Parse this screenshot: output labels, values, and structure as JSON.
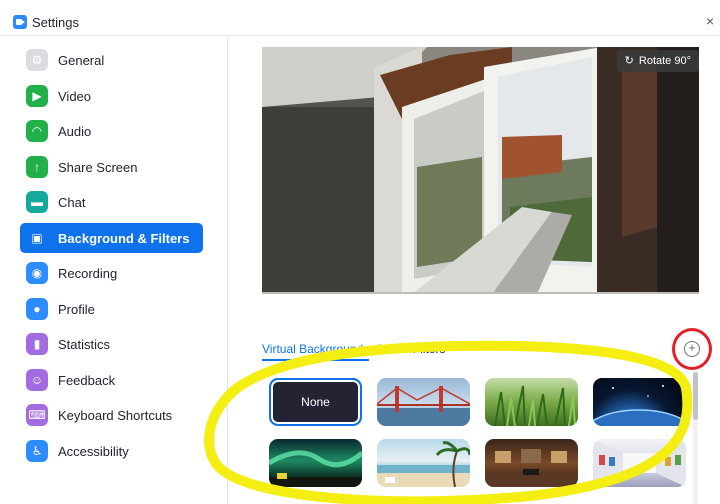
{
  "window": {
    "title": "Settings",
    "close_glyph": "×"
  },
  "sidebar": {
    "items": [
      {
        "label": "General",
        "icon": "gear-icon",
        "color": "#dcdce0",
        "glyph": "⚙"
      },
      {
        "label": "Video",
        "icon": "video-icon",
        "color": "#22b04a",
        "glyph": "▶"
      },
      {
        "label": "Audio",
        "icon": "headphones-icon",
        "color": "#22b04a",
        "glyph": "◠"
      },
      {
        "label": "Share Screen",
        "icon": "share-screen-icon",
        "color": "#22b04a",
        "glyph": "↑"
      },
      {
        "label": "Chat",
        "icon": "chat-icon",
        "color": "#15a89c",
        "glyph": "▬"
      },
      {
        "label": "Background & Filters",
        "icon": "background-icon",
        "color": "#0e72ed",
        "glyph": "▣"
      },
      {
        "label": "Recording",
        "icon": "recording-icon",
        "color": "#2d8cff",
        "glyph": "◉"
      },
      {
        "label": "Profile",
        "icon": "profile-icon",
        "color": "#2d8cff",
        "glyph": "●"
      },
      {
        "label": "Statistics",
        "icon": "statistics-icon",
        "color": "#a26ce0",
        "glyph": "▮"
      },
      {
        "label": "Feedback",
        "icon": "feedback-icon",
        "color": "#a26ce0",
        "glyph": "☺"
      },
      {
        "label": "Keyboard Shortcuts",
        "icon": "keyboard-icon",
        "color": "#a26ce0",
        "glyph": "⌨"
      },
      {
        "label": "Accessibility",
        "icon": "accessibility-icon",
        "color": "#2d8cff",
        "glyph": "♿"
      }
    ],
    "active_index": 5
  },
  "preview": {
    "rotate_label": "Rotate 90°",
    "rotate_glyph": "↻"
  },
  "tabs": [
    {
      "label": "Virtual Backgrounds",
      "active": true
    },
    {
      "label": "Video Filters",
      "active": false
    }
  ],
  "add_button": {
    "glyph": "+"
  },
  "backgrounds": [
    {
      "label": "None",
      "selected": true
    },
    {
      "label": "",
      "kind": "golden-gate"
    },
    {
      "label": "",
      "kind": "grass"
    },
    {
      "label": "",
      "kind": "earth"
    },
    {
      "label": "",
      "kind": "aurora"
    },
    {
      "label": "",
      "kind": "beach"
    },
    {
      "label": "",
      "kind": "gallery"
    },
    {
      "label": "",
      "kind": "hall"
    }
  ],
  "colors": {
    "accent": "#0e72ed",
    "highlight_yellow": "#f5ee13",
    "highlight_red": "#e2202a"
  }
}
